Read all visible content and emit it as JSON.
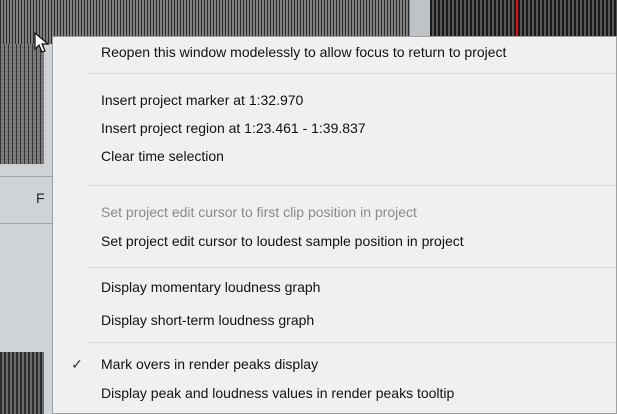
{
  "background": {
    "track_label": "F",
    "colors": {
      "menu_bg": "#f0f0f0",
      "marker": "#d11111"
    }
  },
  "context_menu": {
    "items": [
      {
        "label": "Reopen this window modelessly to allow focus to return to project",
        "checked": false,
        "disabled": false
      },
      {
        "label": "Insert project marker at 1:32.970",
        "checked": false,
        "disabled": false
      },
      {
        "label": "Insert project region at 1:23.461 - 1:39.837",
        "checked": false,
        "disabled": false
      },
      {
        "label": "Clear time selection",
        "checked": false,
        "disabled": false
      },
      {
        "label": "Set project edit cursor to first clip position in project",
        "checked": false,
        "disabled": true
      },
      {
        "label": "Set project edit cursor to loudest sample position in project",
        "checked": false,
        "disabled": false
      },
      {
        "label": "Display momentary loudness graph",
        "checked": false,
        "disabled": false
      },
      {
        "label": "Display short-term loudness graph",
        "checked": false,
        "disabled": false
      },
      {
        "label": "Mark overs in render peaks display",
        "checked": true,
        "disabled": false
      },
      {
        "label": "Display peak and loudness values in render peaks tooltip",
        "checked": false,
        "disabled": false
      }
    ],
    "check_glyph": "✓"
  },
  "icons": {
    "cursor": "mouse-pointer-icon",
    "check": "checkmark-icon"
  }
}
